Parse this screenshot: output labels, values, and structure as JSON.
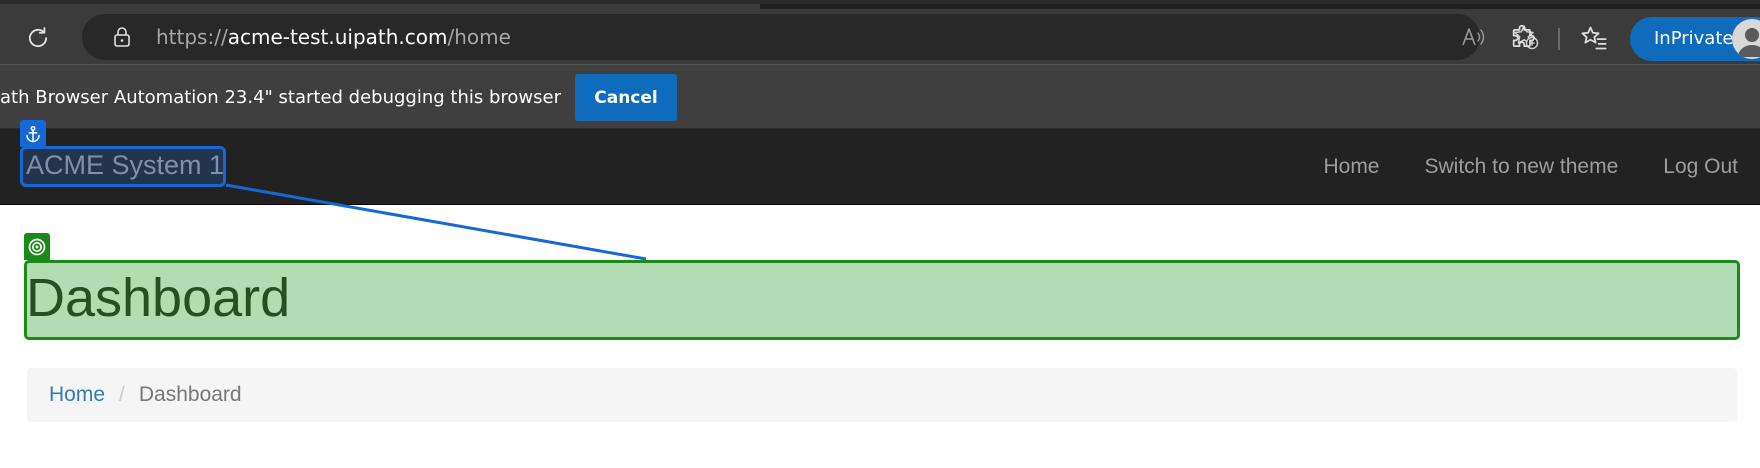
{
  "browser": {
    "url_scheme": "https://",
    "url_host": "acme-test.uipath.com",
    "url_path": "/home",
    "inprivate_label": "InPrivate",
    "icons": {
      "reload": "reload-icon",
      "lock": "lock-icon",
      "read_aloud": "read-aloud-icon",
      "add_favorite": "add-favorite-icon",
      "extensions": "extensions-icon",
      "favorites": "favorites-icon"
    },
    "accent_color": "#0f6cbd"
  },
  "info_bar": {
    "message": "ath Browser Automation 23.4\" started debugging this browser",
    "cancel_label": "Cancel"
  },
  "navbar": {
    "brand": "ACME System 1",
    "links": [
      {
        "label": "Home"
      },
      {
        "label": "Switch to new theme"
      },
      {
        "label": "Log Out"
      }
    ]
  },
  "overlay": {
    "anchor_icon": "anchor-icon",
    "target_icon": "target-icon",
    "anchor_color": "#1668d6",
    "target_color": "#1b8a1b"
  },
  "main": {
    "title": "Dashboard",
    "breadcrumb": {
      "home": "Home",
      "separator": "/",
      "current": "Dashboard"
    }
  }
}
